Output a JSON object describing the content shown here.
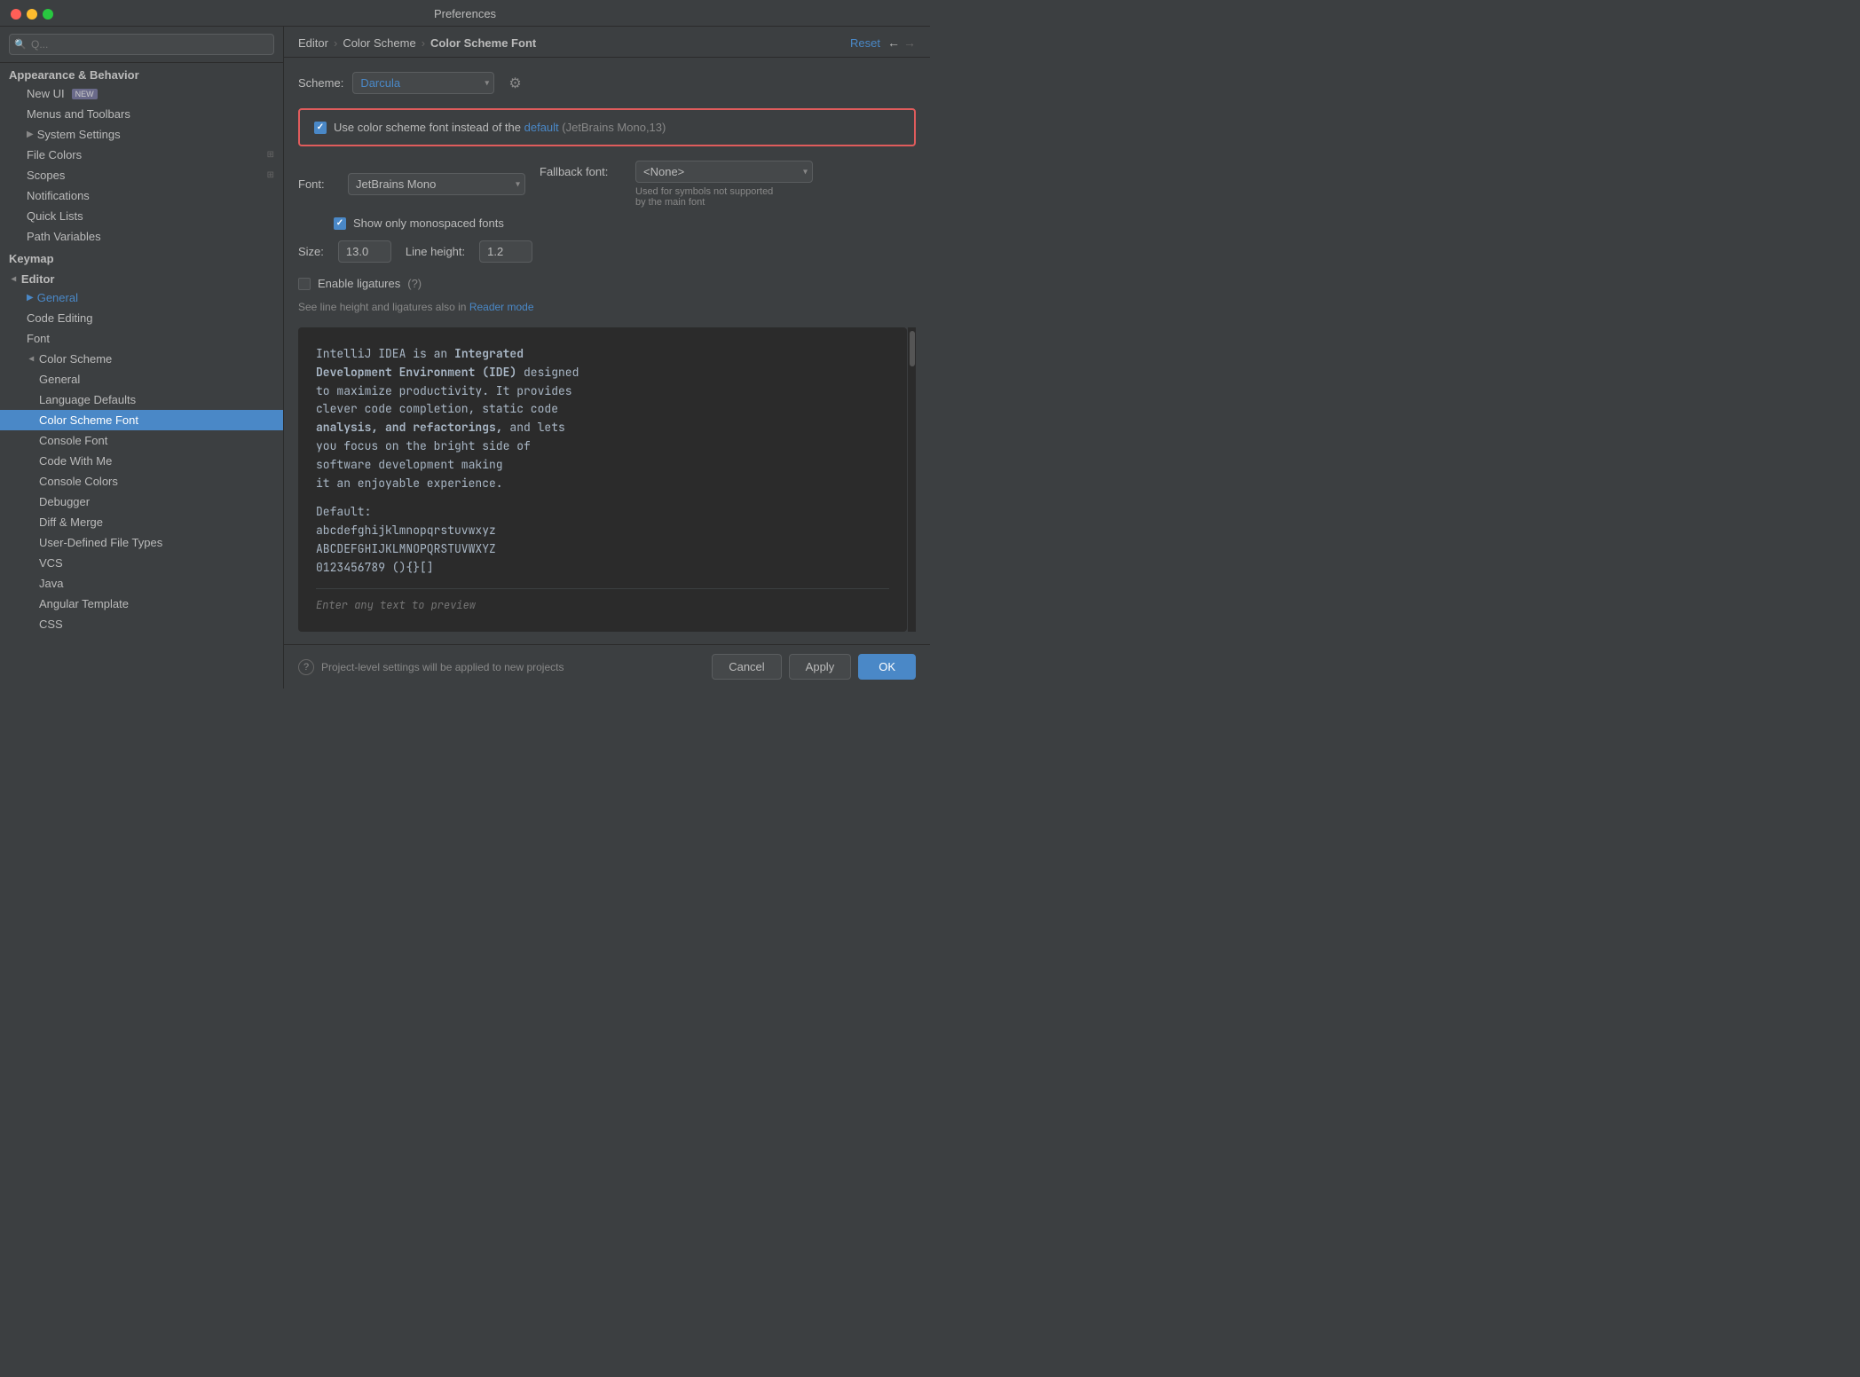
{
  "window": {
    "title": "Preferences"
  },
  "sidebar": {
    "search_placeholder": "Q...",
    "sections": [
      {
        "type": "header",
        "label": "Appearance & Behavior"
      },
      {
        "type": "item",
        "label": "New UI",
        "indent": "sub",
        "badge": "NEW"
      },
      {
        "type": "item",
        "label": "Menus and Toolbars",
        "indent": "sub"
      },
      {
        "type": "item",
        "label": "System Settings",
        "indent": "sub",
        "arrow": "right"
      },
      {
        "type": "item",
        "label": "File Colors",
        "indent": "sub",
        "icon": "grid"
      },
      {
        "type": "item",
        "label": "Scopes",
        "indent": "sub",
        "icon": "grid"
      },
      {
        "type": "item",
        "label": "Notifications",
        "indent": "sub"
      },
      {
        "type": "item",
        "label": "Quick Lists",
        "indent": "sub"
      },
      {
        "type": "item",
        "label": "Path Variables",
        "indent": "sub"
      },
      {
        "type": "header",
        "label": "Keymap"
      },
      {
        "type": "header",
        "label": "Editor",
        "open": true,
        "arrow": "down"
      },
      {
        "type": "item",
        "label": "General",
        "indent": "sub",
        "arrow": "right",
        "color": "blue"
      },
      {
        "type": "item",
        "label": "Code Editing",
        "indent": "sub"
      },
      {
        "type": "item",
        "label": "Font",
        "indent": "sub"
      },
      {
        "type": "item",
        "label": "Color Scheme",
        "indent": "sub",
        "arrow": "down",
        "open": true
      },
      {
        "type": "item",
        "label": "General",
        "indent": "subsub"
      },
      {
        "type": "item",
        "label": "Language Defaults",
        "indent": "subsub"
      },
      {
        "type": "item",
        "label": "Color Scheme Font",
        "indent": "subsub",
        "active": true
      },
      {
        "type": "item",
        "label": "Console Font",
        "indent": "subsub"
      },
      {
        "type": "item",
        "label": "Code With Me",
        "indent": "subsub"
      },
      {
        "type": "item",
        "label": "Console Colors",
        "indent": "subsub"
      },
      {
        "type": "item",
        "label": "Debugger",
        "indent": "subsub"
      },
      {
        "type": "item",
        "label": "Diff & Merge",
        "indent": "subsub"
      },
      {
        "type": "item",
        "label": "User-Defined File Types",
        "indent": "subsub"
      },
      {
        "type": "item",
        "label": "VCS",
        "indent": "subsub"
      },
      {
        "type": "item",
        "label": "Java",
        "indent": "subsub"
      },
      {
        "type": "item",
        "label": "Angular Template",
        "indent": "subsub"
      },
      {
        "type": "item",
        "label": "CSS",
        "indent": "subsub"
      }
    ]
  },
  "breadcrumb": {
    "parts": [
      "Editor",
      "Color Scheme",
      "Color Scheme Font"
    ]
  },
  "header": {
    "reset_label": "Reset",
    "back_arrow": "←",
    "forward_arrow": "→"
  },
  "scheme": {
    "label": "Scheme:",
    "value": "Darcula"
  },
  "use_color_scheme": {
    "checked": true,
    "text_before": "Use color scheme font instead of the",
    "link_text": "default",
    "text_after": "(JetBrains Mono,13)"
  },
  "font": {
    "label": "Font:",
    "value": "JetBrains Mono",
    "show_mono_label": "Show only monospaced fonts",
    "show_mono_checked": true
  },
  "fallback": {
    "label": "Fallback font:",
    "value": "<None>",
    "note_line1": "Used for symbols not supported",
    "note_line2": "by the main font"
  },
  "size": {
    "label": "Size:",
    "value": "13.0"
  },
  "line_height": {
    "label": "Line height:",
    "value": "1.2"
  },
  "ligatures": {
    "label": "Enable ligatures",
    "checked": false
  },
  "reader_mode": {
    "text_before": "See line height and ligatures also in",
    "link_text": "Reader mode"
  },
  "preview": {
    "line1": "IntelliJ IDEA is an ",
    "line1_bold": "Integrated",
    "line2_bold": "Development Environment (IDE)",
    "line2_rest": " designed",
    "line3": "to maximize productivity. It provides",
    "line4": "clever code completion, static code",
    "line5_bold": "analysis, and refactorings,",
    "line5_rest": " and lets",
    "line6": "you focus on the bright side of",
    "line7": "software development making",
    "line8": "it an enjoyable experience.",
    "line9": "",
    "line10": "Default:",
    "line11": "abcdefghijklmnopqrstuvwxyz",
    "line12": "ABCDEFGHIJKLMNOPQRSTUVWXYZ",
    "line13": " 0123456789  (){}[]",
    "input_placeholder": "Enter any text to preview"
  },
  "bottom": {
    "note": "Project-level settings will be applied to new projects",
    "cancel": "Cancel",
    "apply": "Apply",
    "ok": "OK"
  }
}
